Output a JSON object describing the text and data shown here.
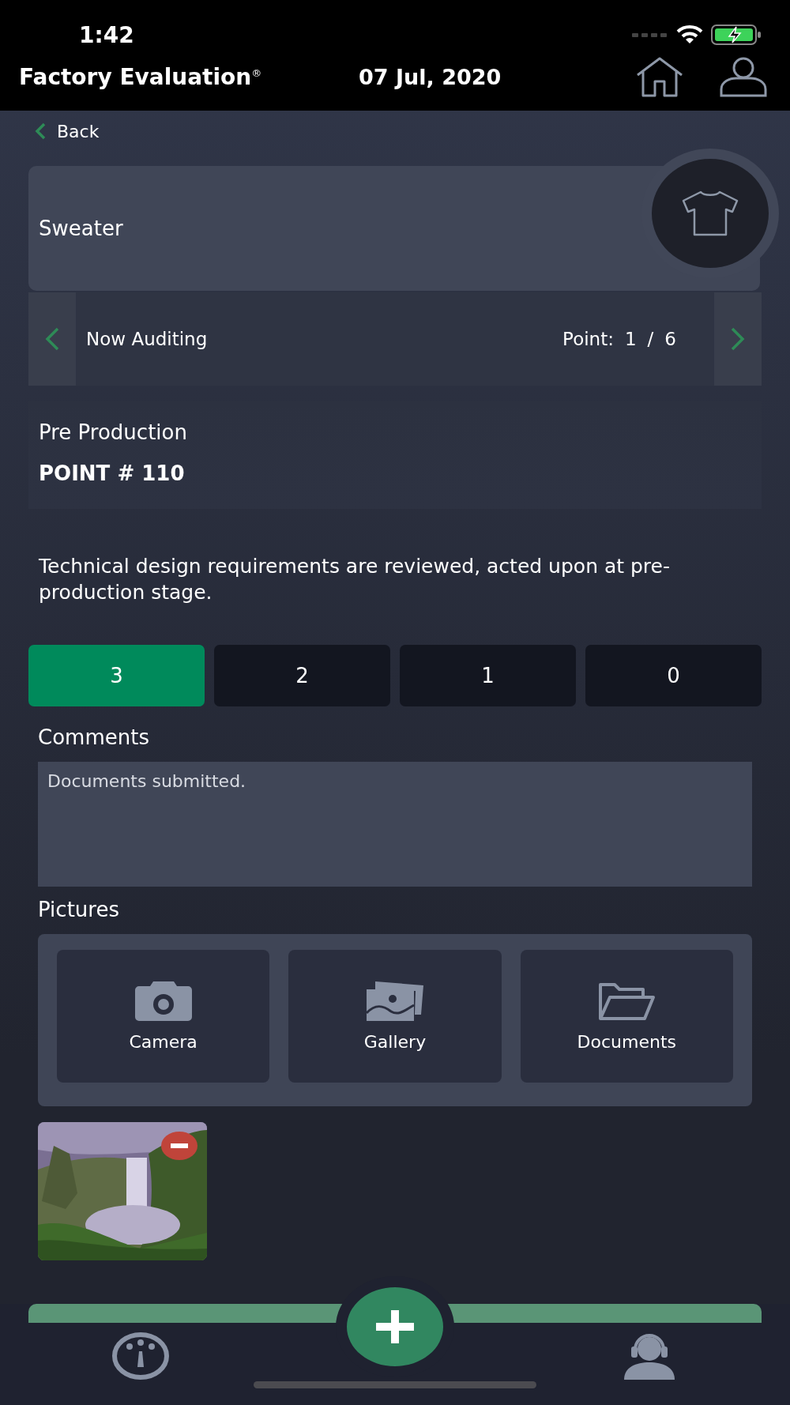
{
  "status_bar": {
    "time": "1:42"
  },
  "header": {
    "title": "Factory Evaluation$^{®}$",
    "date": "07 Jul, 2020"
  },
  "back": {
    "label": "Back"
  },
  "product": {
    "name": "Sweater"
  },
  "audit_nav": {
    "label": "Now Auditing",
    "point_label": "Point:",
    "current": "1",
    "separator": "/",
    "total": "6"
  },
  "point": {
    "category": "Pre Production",
    "number": "POINT # 110",
    "description": "Technical design requirements are reviewed, acted upon at pre-production stage."
  },
  "scores": [
    {
      "label": "3",
      "selected": true
    },
    {
      "label": "2",
      "selected": false
    },
    {
      "label": "1",
      "selected": false
    },
    {
      "label": "0",
      "selected": false
    }
  ],
  "comments": {
    "label": "Comments",
    "value": "Documents submitted."
  },
  "pictures": {
    "label": "Pictures",
    "sources": [
      {
        "kind": "camera",
        "label": "Camera"
      },
      {
        "kind": "gallery",
        "label": "Gallery"
      },
      {
        "kind": "documents",
        "label": "Documents"
      }
    ]
  }
}
